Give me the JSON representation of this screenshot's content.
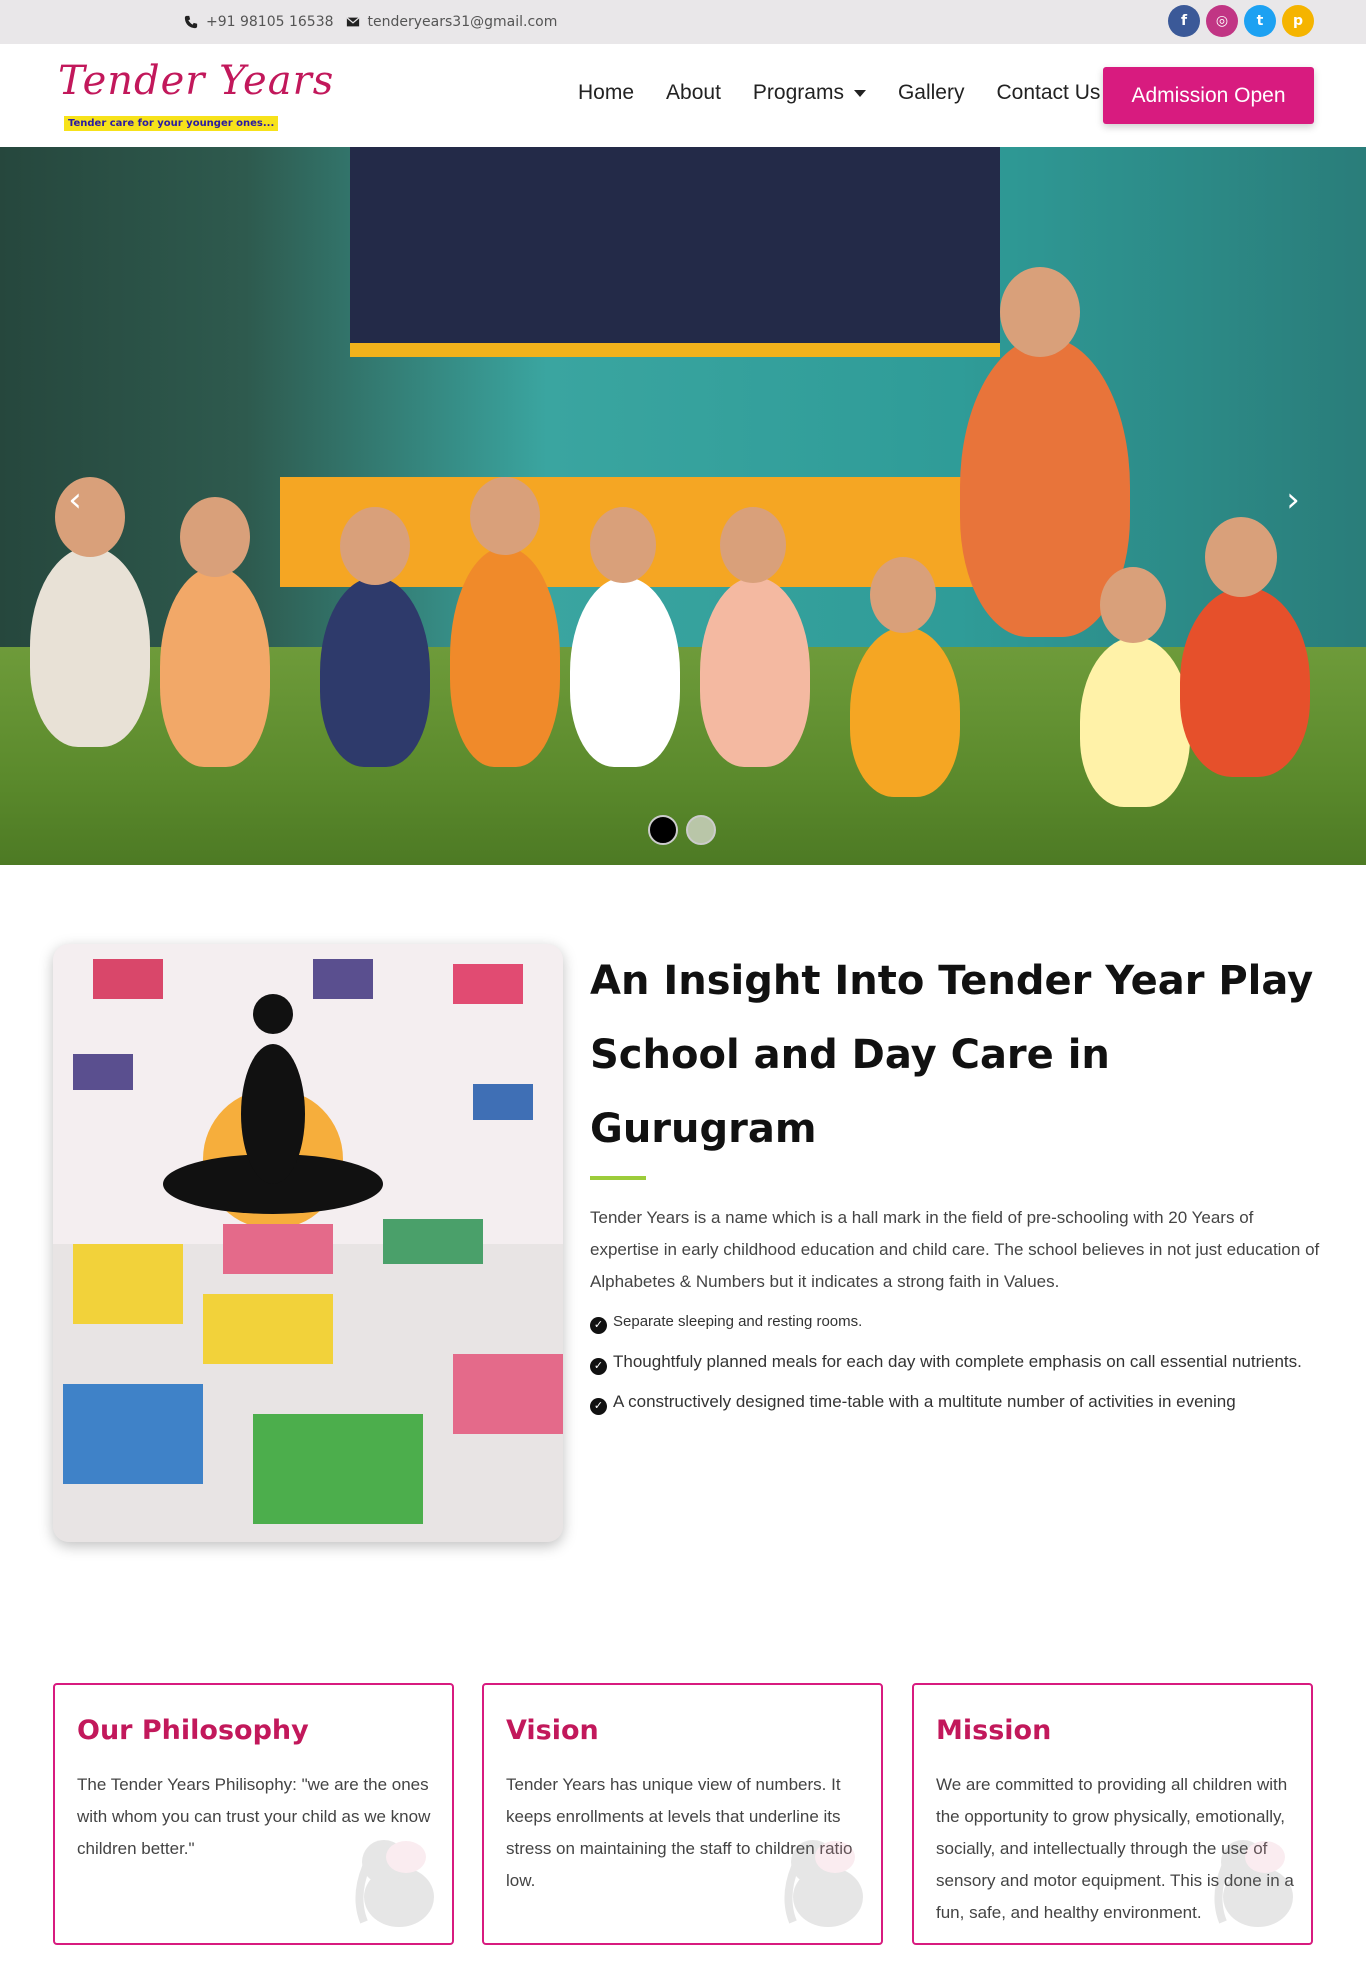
{
  "topbar": {
    "phone": "+91 98105 16538",
    "email": "tenderyears31@gmail.com",
    "socials": [
      {
        "icon": "facebook-icon",
        "glyph": "f",
        "color": "#3b5998"
      },
      {
        "icon": "instagram-icon",
        "glyph": "◎",
        "color": "#c13584"
      },
      {
        "icon": "twitter-icon",
        "glyph": "t",
        "color": "#1da1f2"
      },
      {
        "icon": "pinterest-icon",
        "glyph": "p",
        "color": "#f5b400"
      }
    ]
  },
  "logo": {
    "title": "Tender Years",
    "tagline": "Tender care for your younger ones..."
  },
  "nav": {
    "home": "Home",
    "about": "About",
    "programs": "Programs",
    "gallery": "Gallery",
    "contact": "Contact Us",
    "cta": "Admission Open"
  },
  "hero": {
    "prev_icon": "chevron-left-icon",
    "next_icon": "chevron-right-icon",
    "slides": 2,
    "active_slide": 1
  },
  "insight": {
    "title": "An Insight Into Tender Year Play School and Day Care in Gurugram",
    "paragraph": "Tender Years is a name which is a hall mark in the field of pre-schooling with 20 Years of expertise in early childhood education and child care. The school believes in not just education of Alphabetes & Numbers but it indicates a strong faith in Values.",
    "bullets": [
      "Separate sleeping and resting rooms.",
      "Thoughtfuly planned meals for each day with complete emphasis on call essential nutrients.",
      "A constructively designed time-table with a multitute number of activities in evening"
    ]
  },
  "cards": [
    {
      "title": "Our Philosophy",
      "text": "The Tender Years Philisophy: \"we are the ones with whom you can trust your child as we know children better.\""
    },
    {
      "title": "Vision",
      "text": "Tender Years has unique view of numbers. It keeps enrollments at levels that underline its stress on maintaining the staff to children ratio low."
    },
    {
      "title": "Mission",
      "text": "We are committed to providing all children with the opportunity to grow physically, emotionally, socially, and intellectually through the use of sensory and motor equipment. This is done in a fun, safe, and healthy environment."
    }
  ],
  "colors": {
    "accent": "#d81b7f",
    "title_pink": "#c2185b",
    "rule_green": "#9ccc3a"
  }
}
